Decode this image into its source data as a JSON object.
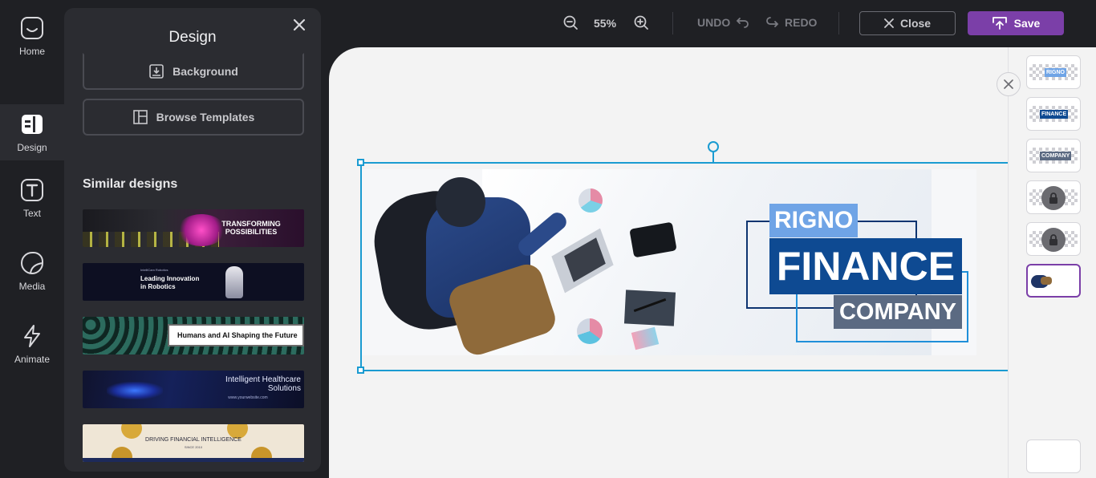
{
  "rail": {
    "items": [
      {
        "label": "Home",
        "icon": "home-icon"
      },
      {
        "label": "Design",
        "icon": "design-icon"
      },
      {
        "label": "Text",
        "icon": "text-icon"
      },
      {
        "label": "Media",
        "icon": "media-icon"
      },
      {
        "label": "Animate",
        "icon": "animate-icon"
      }
    ],
    "active": "Design"
  },
  "panel": {
    "title": "Design",
    "background_label": "Background",
    "templates_label": "Browse Templates",
    "similar_heading": "Similar designs",
    "thumbs": [
      {
        "line1": "TRANSFORMING",
        "line2": "POSSIBILITIES"
      },
      {
        "small": "IntelliCam Robotics",
        "line1": "Leading Innovation",
        "line2": "in Robotics"
      },
      {
        "line1": "Humans and AI Shaping the Future"
      },
      {
        "line1": "Intelligent Healthcare",
        "line2": "Solutions",
        "small": "www.yourwebsite.com"
      },
      {
        "line1": "DRIVING FINANCIAL INTELLIGENCE",
        "small": "SINCE 2010"
      }
    ]
  },
  "toolbar": {
    "zoom": "55%",
    "undo_label": "UNDO",
    "redo_label": "REDO",
    "close_label": "Close",
    "save_label": "Save"
  },
  "banner": {
    "line1": "RIGNO",
    "line2": "FINANCE",
    "line3": "COMPANY"
  },
  "layers": [
    {
      "tag": "RIGNO"
    },
    {
      "tag": "FINANCE"
    },
    {
      "tag": "COMPANY"
    }
  ],
  "colors": {
    "accent": "#7b3fa8",
    "selection": "#1a9bd1",
    "brand_dark": "#0e4a92",
    "brand_light": "#6fa4e6",
    "brand_grey": "#5b6a82"
  }
}
